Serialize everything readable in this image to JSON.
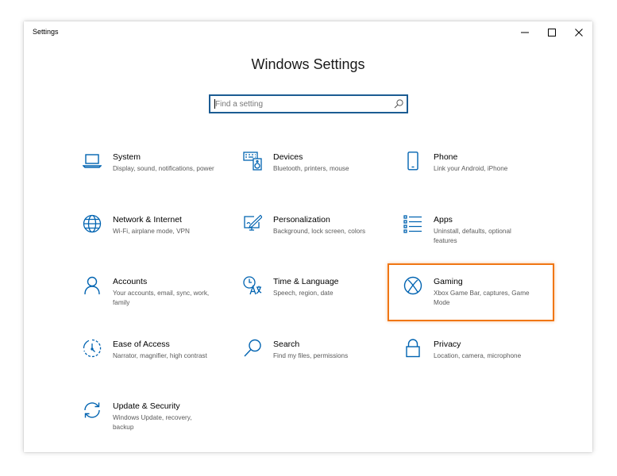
{
  "window": {
    "app_title": "Settings",
    "controls": {
      "minimize": "minimize-icon",
      "maximize": "maximize-icon",
      "close": "close-icon"
    }
  },
  "main": {
    "title": "Windows Settings",
    "search": {
      "placeholder": "Find a setting",
      "icon": "search-icon"
    }
  },
  "accent_color": "#0063b1",
  "highlight_color": "#f07614",
  "highlighted_tile": "Gaming",
  "categories": [
    {
      "label": "System",
      "description": "Display, sound, notifications, power",
      "icon": "laptop-icon"
    },
    {
      "label": "Devices",
      "description": "Bluetooth, printers, mouse",
      "icon": "devices-icon"
    },
    {
      "label": "Phone",
      "description": "Link your Android, iPhone",
      "icon": "phone-icon"
    },
    {
      "label": "Network & Internet",
      "description": "Wi-Fi, airplane mode, VPN",
      "icon": "globe-icon"
    },
    {
      "label": "Personalization",
      "description": "Background, lock screen, colors",
      "icon": "pen-on-screen-icon"
    },
    {
      "label": "Apps",
      "description": "Uninstall, defaults, optional features",
      "icon": "apps-list-icon"
    },
    {
      "label": "Accounts",
      "description": "Your accounts, email, sync, work, family",
      "icon": "person-icon"
    },
    {
      "label": "Time & Language",
      "description": "Speech, region, date",
      "icon": "clock-language-icon"
    },
    {
      "label": "Gaming",
      "description": "Xbox Game Bar, captures, Game Mode",
      "icon": "xbox-icon"
    },
    {
      "label": "Ease of Access",
      "description": "Narrator, magnifier, high contrast",
      "icon": "ease-of-access-icon"
    },
    {
      "label": "Search",
      "description": "Find my files, permissions",
      "icon": "magnifier-icon"
    },
    {
      "label": "Privacy",
      "description": "Location, camera, microphone",
      "icon": "lock-icon"
    },
    {
      "label": "Update & Security",
      "description": "Windows Update, recovery, backup",
      "icon": "sync-arrows-icon"
    }
  ]
}
